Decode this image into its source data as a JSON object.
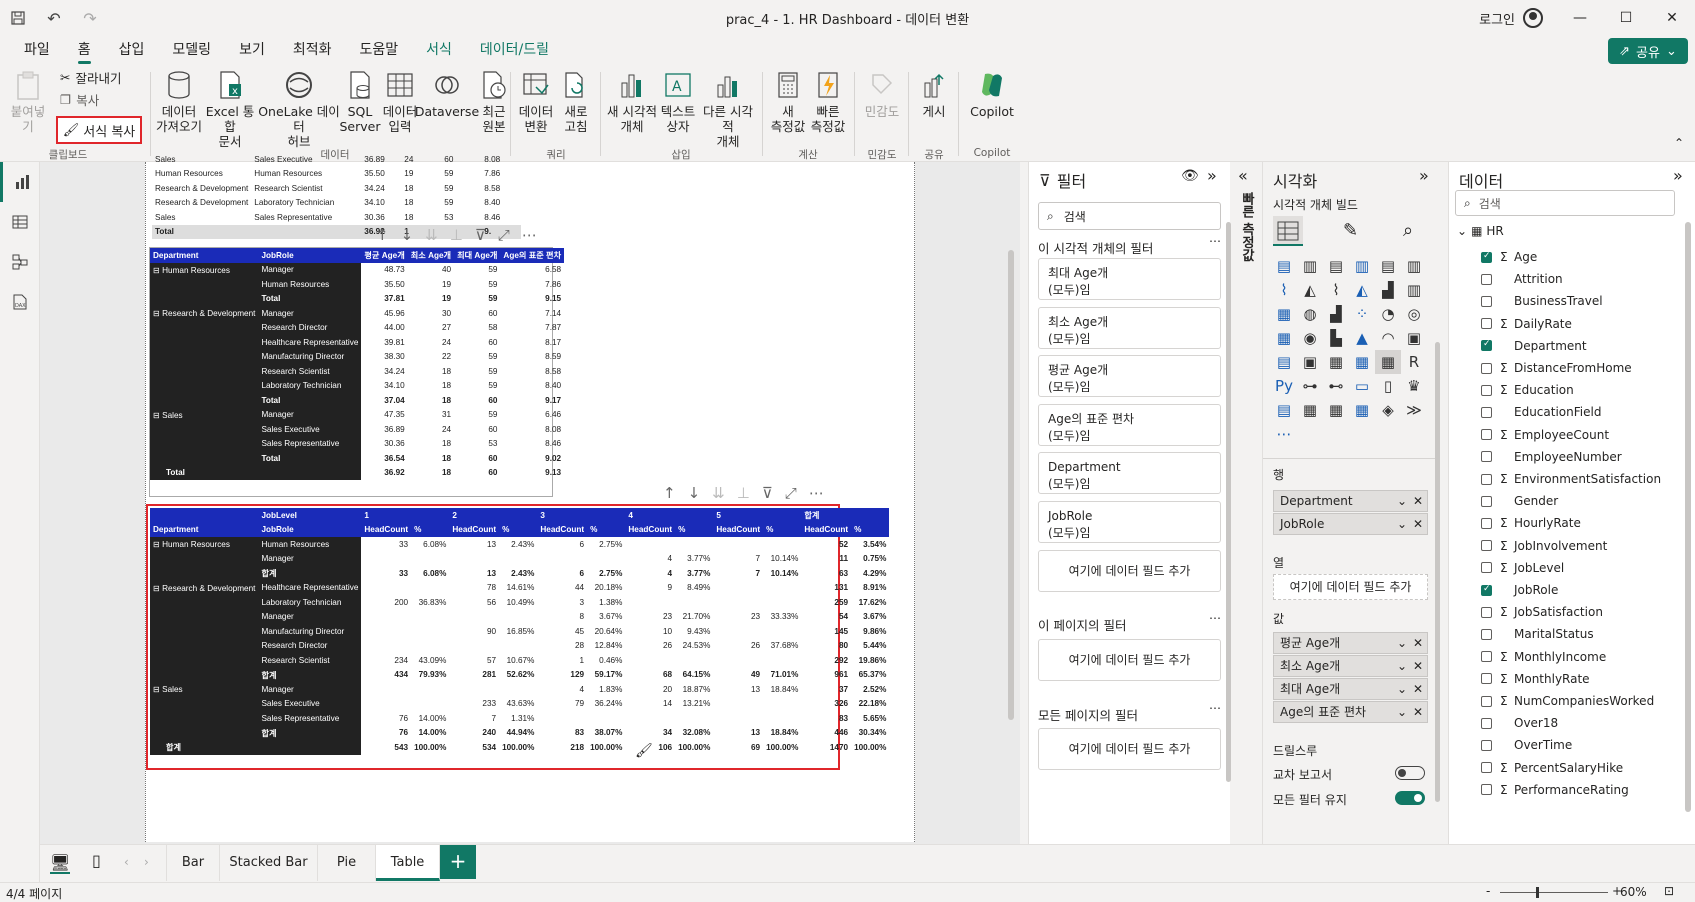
{
  "title": "prac_4 - 1. HR Dashboard - 데이터 변환",
  "login": "로그인",
  "tabs": [
    "파일",
    "홈",
    "삽입",
    "모델링",
    "보기",
    "최적화",
    "도움말",
    "서식",
    "데이터/드릴"
  ],
  "share": "공유",
  "ribbon": {
    "clipboard": {
      "paste": "붙여넣기",
      "cut": "잘라내기",
      "copy": "복사",
      "format_painter": "서식 복사",
      "group": "클립보드"
    },
    "data": {
      "get_data": [
        "데이터",
        "가져오기"
      ],
      "excel": [
        "Excel 통합",
        "문서"
      ],
      "onelake": [
        "OneLake 데이터",
        "허브"
      ],
      "sql": [
        "SQL",
        "Server"
      ],
      "enter": [
        "데이터",
        "입력"
      ],
      "dataverse": [
        "Dataverse",
        ""
      ],
      "recent": [
        "최근",
        "원본"
      ],
      "group": "데이터"
    },
    "query": {
      "transform": [
        "데이터",
        "변환"
      ],
      "refresh": [
        "새로",
        "고침"
      ],
      "group": "쿼리"
    },
    "insert": {
      "newvis": [
        "새 시각적",
        "개체"
      ],
      "textbox": [
        "텍스트",
        "상자"
      ],
      "othervis": [
        "다른 시각적",
        "개체"
      ],
      "group": "삽입"
    },
    "calc": {
      "measure": [
        "새",
        "측정값"
      ],
      "quick": [
        "빠른",
        "측정값"
      ],
      "group": "계산"
    },
    "sens": {
      "label": [
        "민감도",
        ""
      ],
      "group": "민감도"
    },
    "share": {
      "publish": [
        "게시",
        ""
      ],
      "group": "공유"
    },
    "copilot": {
      "label": [
        "Copilot",
        ""
      ],
      "group": "Copilot"
    }
  },
  "table_top": {
    "rows": [
      [
        "Sales",
        "Sales Executive",
        "36.89",
        "24",
        "60",
        "8.08"
      ],
      [
        "Human Resources",
        "Human Resources",
        "35.50",
        "19",
        "59",
        "7.86"
      ],
      [
        "Research & Development",
        "Research Scientist",
        "34.24",
        "18",
        "59",
        "8.58"
      ],
      [
        "Research & Development",
        "Laboratory Technician",
        "34.10",
        "18",
        "59",
        "8.40"
      ],
      [
        "Sales",
        "Sales Representative",
        "30.36",
        "18",
        "53",
        "8.46"
      ]
    ],
    "total": [
      "Total",
      "",
      "36.92",
      "1",
      "",
      "9."
    ]
  },
  "matrix1": {
    "headers": [
      "Department",
      "JobRole",
      "평균 Age개",
      "최소 Age개",
      "최대 Age개",
      "Age의 표준 편차"
    ],
    "groups": [
      {
        "dept": "Human Resources",
        "rows": [
          [
            "Manager",
            "48.73",
            "40",
            "59",
            "6.58"
          ],
          [
            "Human Resources",
            "35.50",
            "19",
            "59",
            "7.86"
          ]
        ],
        "total": [
          "Total",
          "37.81",
          "19",
          "59",
          "9.15"
        ]
      },
      {
        "dept": "Research & Development",
        "rows": [
          [
            "Manager",
            "45.96",
            "30",
            "60",
            "7.14"
          ],
          [
            "Research Director",
            "44.00",
            "27",
            "58",
            "7.87"
          ],
          [
            "Healthcare Representative",
            "39.81",
            "24",
            "60",
            "8.17"
          ],
          [
            "Manufacturing Director",
            "38.30",
            "22",
            "59",
            "8.59"
          ],
          [
            "Research Scientist",
            "34.24",
            "18",
            "59",
            "8.58"
          ],
          [
            "Laboratory Technician",
            "34.10",
            "18",
            "59",
            "8.40"
          ]
        ],
        "total": [
          "Total",
          "37.04",
          "18",
          "60",
          "9.17"
        ]
      },
      {
        "dept": "Sales",
        "rows": [
          [
            "Manager",
            "47.35",
            "31",
            "59",
            "6.46"
          ],
          [
            "Sales Executive",
            "36.89",
            "24",
            "60",
            "8.08"
          ],
          [
            "Sales Representative",
            "30.36",
            "18",
            "53",
            "8.46"
          ]
        ],
        "total": [
          "Total",
          "36.54",
          "18",
          "60",
          "9.02"
        ]
      }
    ],
    "grand": [
      "Total",
      "36.92",
      "18",
      "60",
      "9.13"
    ]
  },
  "matrix2": {
    "h1": [
      "JobLevel",
      "1",
      "2",
      "3",
      "4",
      "5",
      "합계"
    ],
    "h2": [
      "Department",
      "JobRole",
      "HeadCount",
      "%",
      "HeadCount",
      "%",
      "HeadCount",
      "%",
      "HeadCount",
      "%",
      "HeadCount",
      "%",
      "HeadCount",
      "%"
    ],
    "groups": [
      {
        "dept": "Human Resources",
        "rows": [
          [
            "Human Resources",
            "33",
            "6.08%",
            "13",
            "2.43%",
            "6",
            "2.75%",
            "",
            "",
            "",
            "",
            "52",
            "3.54%"
          ],
          [
            "Manager",
            "",
            "",
            "",
            "",
            "",
            "",
            "4",
            "3.77%",
            "7",
            "10.14%",
            "11",
            "0.75%"
          ]
        ],
        "total": [
          "합계",
          "33",
          "6.08%",
          "13",
          "2.43%",
          "6",
          "2.75%",
          "4",
          "3.77%",
          "7",
          "10.14%",
          "63",
          "4.29%"
        ]
      },
      {
        "dept": "Research & Development",
        "rows": [
          [
            "Healthcare Representative",
            "",
            "",
            "78",
            "14.61%",
            "44",
            "20.18%",
            "9",
            "8.49%",
            "",
            "",
            "131",
            "8.91%"
          ],
          [
            "Laboratory Technician",
            "200",
            "36.83%",
            "56",
            "10.49%",
            "3",
            "1.38%",
            "",
            "",
            "",
            "",
            "259",
            "17.62%"
          ],
          [
            "Manager",
            "",
            "",
            "",
            "",
            "8",
            "3.67%",
            "23",
            "21.70%",
            "23",
            "33.33%",
            "54",
            "3.67%"
          ],
          [
            "Manufacturing Director",
            "",
            "",
            "90",
            "16.85%",
            "45",
            "20.64%",
            "10",
            "9.43%",
            "",
            "",
            "145",
            "9.86%"
          ],
          [
            "Research Director",
            "",
            "",
            "",
            "",
            "28",
            "12.84%",
            "26",
            "24.53%",
            "26",
            "37.68%",
            "80",
            "5.44%"
          ],
          [
            "Research Scientist",
            "234",
            "43.09%",
            "57",
            "10.67%",
            "1",
            "0.46%",
            "",
            "",
            "",
            "",
            "292",
            "19.86%"
          ]
        ],
        "total": [
          "합계",
          "434",
          "79.93%",
          "281",
          "52.62%",
          "129",
          "59.17%",
          "68",
          "64.15%",
          "49",
          "71.01%",
          "961",
          "65.37%"
        ]
      },
      {
        "dept": "Sales",
        "rows": [
          [
            "Manager",
            "",
            "",
            "",
            "",
            "4",
            "1.83%",
            "20",
            "18.87%",
            "13",
            "18.84%",
            "37",
            "2.52%"
          ],
          [
            "Sales Executive",
            "",
            "",
            "233",
            "43.63%",
            "79",
            "36.24%",
            "14",
            "13.21%",
            "",
            "",
            "326",
            "22.18%"
          ],
          [
            "Sales Representative",
            "76",
            "14.00%",
            "7",
            "1.31%",
            "",
            "",
            "",
            "",
            "",
            "",
            "83",
            "5.65%"
          ]
        ],
        "total": [
          "합계",
          "76",
          "14.00%",
          "240",
          "44.94%",
          "83",
          "38.07%",
          "34",
          "32.08%",
          "13",
          "18.84%",
          "446",
          "30.34%"
        ]
      }
    ],
    "grand": [
      "합계",
      "543",
      "100.00%",
      "534",
      "100.00%",
      "218",
      "100.00%",
      "106",
      "100.00%",
      "69",
      "100.00%",
      "1470",
      "100.00%"
    ]
  },
  "filter": {
    "title": "필터",
    "search": "검색",
    "vis_filters": "이 시각적 개체의 필터",
    "cards": [
      [
        "최대 Age개",
        "(모두)임"
      ],
      [
        "최소 Age개",
        "(모두)임"
      ],
      [
        "평균 Age개",
        "(모두)임"
      ],
      [
        "Age의 표준 편차",
        "(모두)임"
      ],
      [
        "Department",
        "(모두)임"
      ],
      [
        "JobRole",
        "(모두)임"
      ]
    ],
    "add": "여기에 데이터 필드 추가",
    "page_filters": "이 페이지의 필터",
    "all_filters": "모든 페이지의 필터"
  },
  "quickmeasure": "빠른 측정값",
  "vis": {
    "title": "시각화",
    "build": "시각적 개체 빌드",
    "rows": "행",
    "row_wells": [
      "Department",
      "JobRole"
    ],
    "cols": "열",
    "add": "여기에 데이터 필드 추가",
    "values": "값",
    "value_wells": [
      "평균 Age개",
      "최소 Age개",
      "최대 Age개",
      "Age의 표준 편차"
    ],
    "drill": "드릴스루",
    "cross": "교차 보고서",
    "keepall": "모든 필터 유지"
  },
  "data": {
    "title": "데이터",
    "search": "검색",
    "table": "HR",
    "fields": [
      {
        "n": "Age",
        "s": true,
        "c": true
      },
      {
        "n": "Attrition",
        "s": false,
        "c": false
      },
      {
        "n": "BusinessTravel",
        "s": false,
        "c": false
      },
      {
        "n": "DailyRate",
        "s": true,
        "c": false
      },
      {
        "n": "Department",
        "s": false,
        "c": true
      },
      {
        "n": "DistanceFromHome",
        "s": true,
        "c": false
      },
      {
        "n": "Education",
        "s": true,
        "c": false
      },
      {
        "n": "EducationField",
        "s": false,
        "c": false
      },
      {
        "n": "EmployeeCount",
        "s": true,
        "c": false
      },
      {
        "n": "EmployeeNumber",
        "s": false,
        "c": false
      },
      {
        "n": "EnvironmentSatisfaction",
        "s": true,
        "c": false
      },
      {
        "n": "Gender",
        "s": false,
        "c": false
      },
      {
        "n": "HourlyRate",
        "s": true,
        "c": false
      },
      {
        "n": "JobInvolvement",
        "s": true,
        "c": false
      },
      {
        "n": "JobLevel",
        "s": true,
        "c": false
      },
      {
        "n": "JobRole",
        "s": false,
        "c": true
      },
      {
        "n": "JobSatisfaction",
        "s": true,
        "c": false
      },
      {
        "n": "MaritalStatus",
        "s": false,
        "c": false
      },
      {
        "n": "MonthlyIncome",
        "s": true,
        "c": false
      },
      {
        "n": "MonthlyRate",
        "s": true,
        "c": false
      },
      {
        "n": "NumCompaniesWorked",
        "s": true,
        "c": false
      },
      {
        "n": "Over18",
        "s": false,
        "c": false
      },
      {
        "n": "OverTime",
        "s": false,
        "c": false
      },
      {
        "n": "PercentSalaryHike",
        "s": true,
        "c": false
      },
      {
        "n": "PerformanceRating",
        "s": true,
        "c": false
      }
    ]
  },
  "pages": [
    "Bar",
    "Stacked Bar",
    "Pie",
    "Table"
  ],
  "status": {
    "page": "4/4 페이지",
    "zoom": "60%"
  },
  "colors": {
    "accent": "#117865",
    "header": "#1a2bb8",
    "highlight": "#e0262b"
  }
}
